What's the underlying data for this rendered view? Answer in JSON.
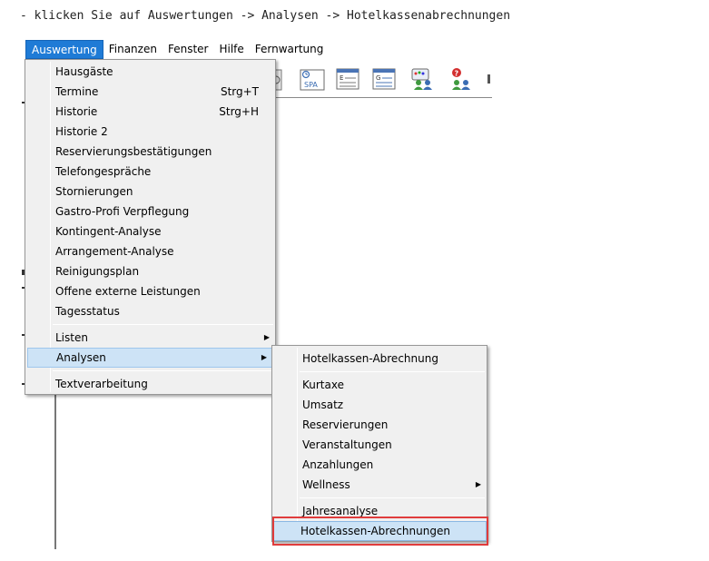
{
  "instruction": "- klicken Sie auf Auswertungen -> Analysen -> Hotelkassenabrechnungen",
  "menubar": {
    "items": [
      "Auswertung",
      "Finanzen",
      "Fenster",
      "Hilfe",
      "Fernwartung"
    ],
    "active": "Auswertung"
  },
  "toolbar": {
    "icons": [
      "clock-icon",
      "spa-icon",
      "document-e-icon",
      "document-g-icon",
      "users-palette-icon",
      "users-help-icon"
    ],
    "spa_label": "SPA"
  },
  "auswertung_menu": {
    "items": [
      {
        "label": "Hausgäste",
        "shortcut": ""
      },
      {
        "label": "Termine",
        "shortcut": "Strg+T"
      },
      {
        "label": "Historie",
        "shortcut": "Strg+H"
      },
      {
        "label": "Historie 2",
        "shortcut": ""
      },
      {
        "label": "Reservierungsbestätigungen",
        "shortcut": ""
      },
      {
        "label": "Telefongespräche",
        "shortcut": ""
      },
      {
        "label": "Stornierungen",
        "shortcut": ""
      },
      {
        "label": "Gastro-Profi Verpflegung",
        "shortcut": ""
      },
      {
        "label": "Kontingent-Analyse",
        "shortcut": ""
      },
      {
        "label": "Arrangement-Analyse",
        "shortcut": ""
      },
      {
        "label": "Reinigungsplan",
        "shortcut": ""
      },
      {
        "label": "Offene externe Leistungen",
        "shortcut": ""
      },
      {
        "label": "Tagesstatus",
        "shortcut": ""
      }
    ],
    "listen": "Listen",
    "analysen": "Analysen",
    "textverarbeitung": "Textverarbeitung"
  },
  "analysen_menu": {
    "top": "Hotelkassen-Abrechnung",
    "items": [
      "Kurtaxe",
      "Umsatz",
      "Reservierungen",
      "Veranstaltungen",
      "Anzahlungen"
    ],
    "wellness": "Wellness",
    "jahresanalyse": "Jahresanalyse",
    "highlighted": "Hotelkassen-Abrechnungen"
  },
  "colors": {
    "menubar_active": "#1f7bd6",
    "hover": "#cde3f6",
    "highlight_box": "#e03c3c"
  }
}
